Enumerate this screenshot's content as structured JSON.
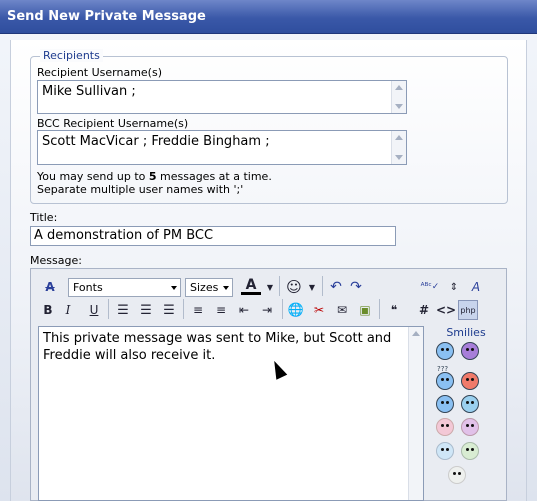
{
  "window": {
    "title": "Send New Private Message"
  },
  "recipients": {
    "legend": "Recipients",
    "to_label": "Recipient Username(s)",
    "to_value": "Mike Sullivan ;",
    "bcc_label": "BCC Recipient Username(s)",
    "bcc_value": "Scott MacVicar ; Freddie Bingham ;",
    "note_prefix": "You may send up to ",
    "note_count": "5",
    "note_suffix": " messages at a time.",
    "note_line2": "Separate multiple user names with ';'"
  },
  "title_field": {
    "label": "Title:",
    "value": "A demonstration of PM BCC"
  },
  "message": {
    "label": "Message:",
    "fonts_select": "Fonts",
    "sizes_select": "Sizes",
    "body": "This private message was sent to Mike, but Scott and Freddie will also receive it."
  },
  "smilies": {
    "title": "Smilies",
    "faces_label": "???"
  },
  "colors": {
    "titlebar": "#3a58a8",
    "accent": "#1d3b8e"
  }
}
